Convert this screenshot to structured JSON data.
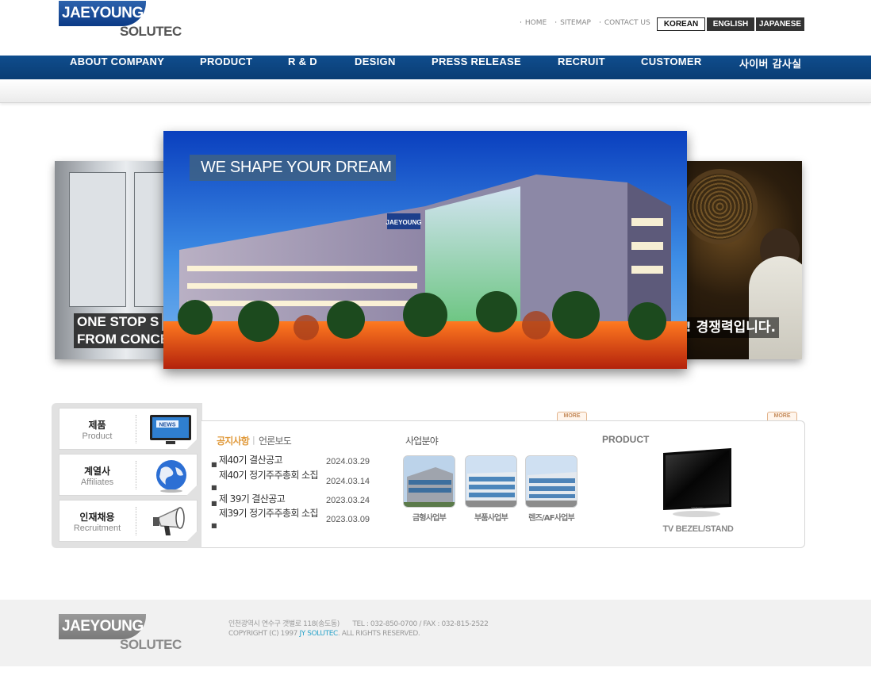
{
  "header": {
    "logo_main": "JAEYOUNG",
    "logo_sub": "SOLUTEC",
    "util_links": [
      "HOME",
      "SITEMAP",
      "CONTACT US"
    ],
    "languages": [
      "KOREAN",
      "ENGLISH",
      "JAPANESE"
    ],
    "selected_language": "KOREAN"
  },
  "nav": {
    "items": [
      "ABOUT COMPANY",
      "PRODUCT",
      "R & D",
      "DESIGN",
      "PRESS RELEASE",
      "RECRUIT",
      "CUSTOMER",
      "사이버 감사실"
    ]
  },
  "visual": {
    "main_slogan": "WE SHAPE YOUR DREAM",
    "left_caption_1": "ONE STOP S",
    "left_caption_2": "FROM CONCE",
    "right_caption": "! 경쟁력입니다.",
    "building_sign": "JAEYOUNG"
  },
  "quick_menu": [
    {
      "ko": "제품",
      "en": "Product",
      "icon": "news-tv-icon"
    },
    {
      "ko": "계열사",
      "en": "Affiliates",
      "icon": "globe-icon"
    },
    {
      "ko": "인재채용",
      "en": "Recruitment",
      "icon": "megaphone-icon"
    }
  ],
  "more_label": "MORE",
  "notice": {
    "tab_active": "공지사항",
    "tab_inactive": "언론보도",
    "items": [
      {
        "title": "제40기 결산공고",
        "date": "2024.03.29"
      },
      {
        "title": "제40기 정기주주총회 소집",
        "date": "2024.03.14"
      },
      {
        "title": "제 39기 결산공고",
        "date": "2023.03.24"
      },
      {
        "title": "제39기 정기주주총회 소집",
        "date": "2023.03.09"
      }
    ]
  },
  "business": {
    "title": "사업분야",
    "items": [
      "금형사업부",
      "부품사업부",
      "렌즈/AF사업부"
    ]
  },
  "product": {
    "title": "PRODUCT",
    "label": "TV BEZEL/STAND",
    "tv_brand": "SAMSUNG"
  },
  "footer": {
    "logo_main": "JAEYOUNG",
    "logo_sub": "SOLUTEC",
    "address": "인천광역시 연수구 갯벌로 118(송도동)",
    "tel": "TEL : 032-850-0700 / FAX : 032-815-2522",
    "copyright_prefix": "COPYRIGHT (C) 1997",
    "copyright_brand": "JY SOLUTEC",
    "copyright_suffix": ". ALL RIGHTS RESERVED."
  },
  "colors": {
    "nav_blue": "#0f4d8d",
    "logo_blue": "#1a4f9c",
    "notice_orange": "#e09a3c",
    "footer_bg": "#f1f1f1",
    "brand_link": "#2aa3c9"
  }
}
